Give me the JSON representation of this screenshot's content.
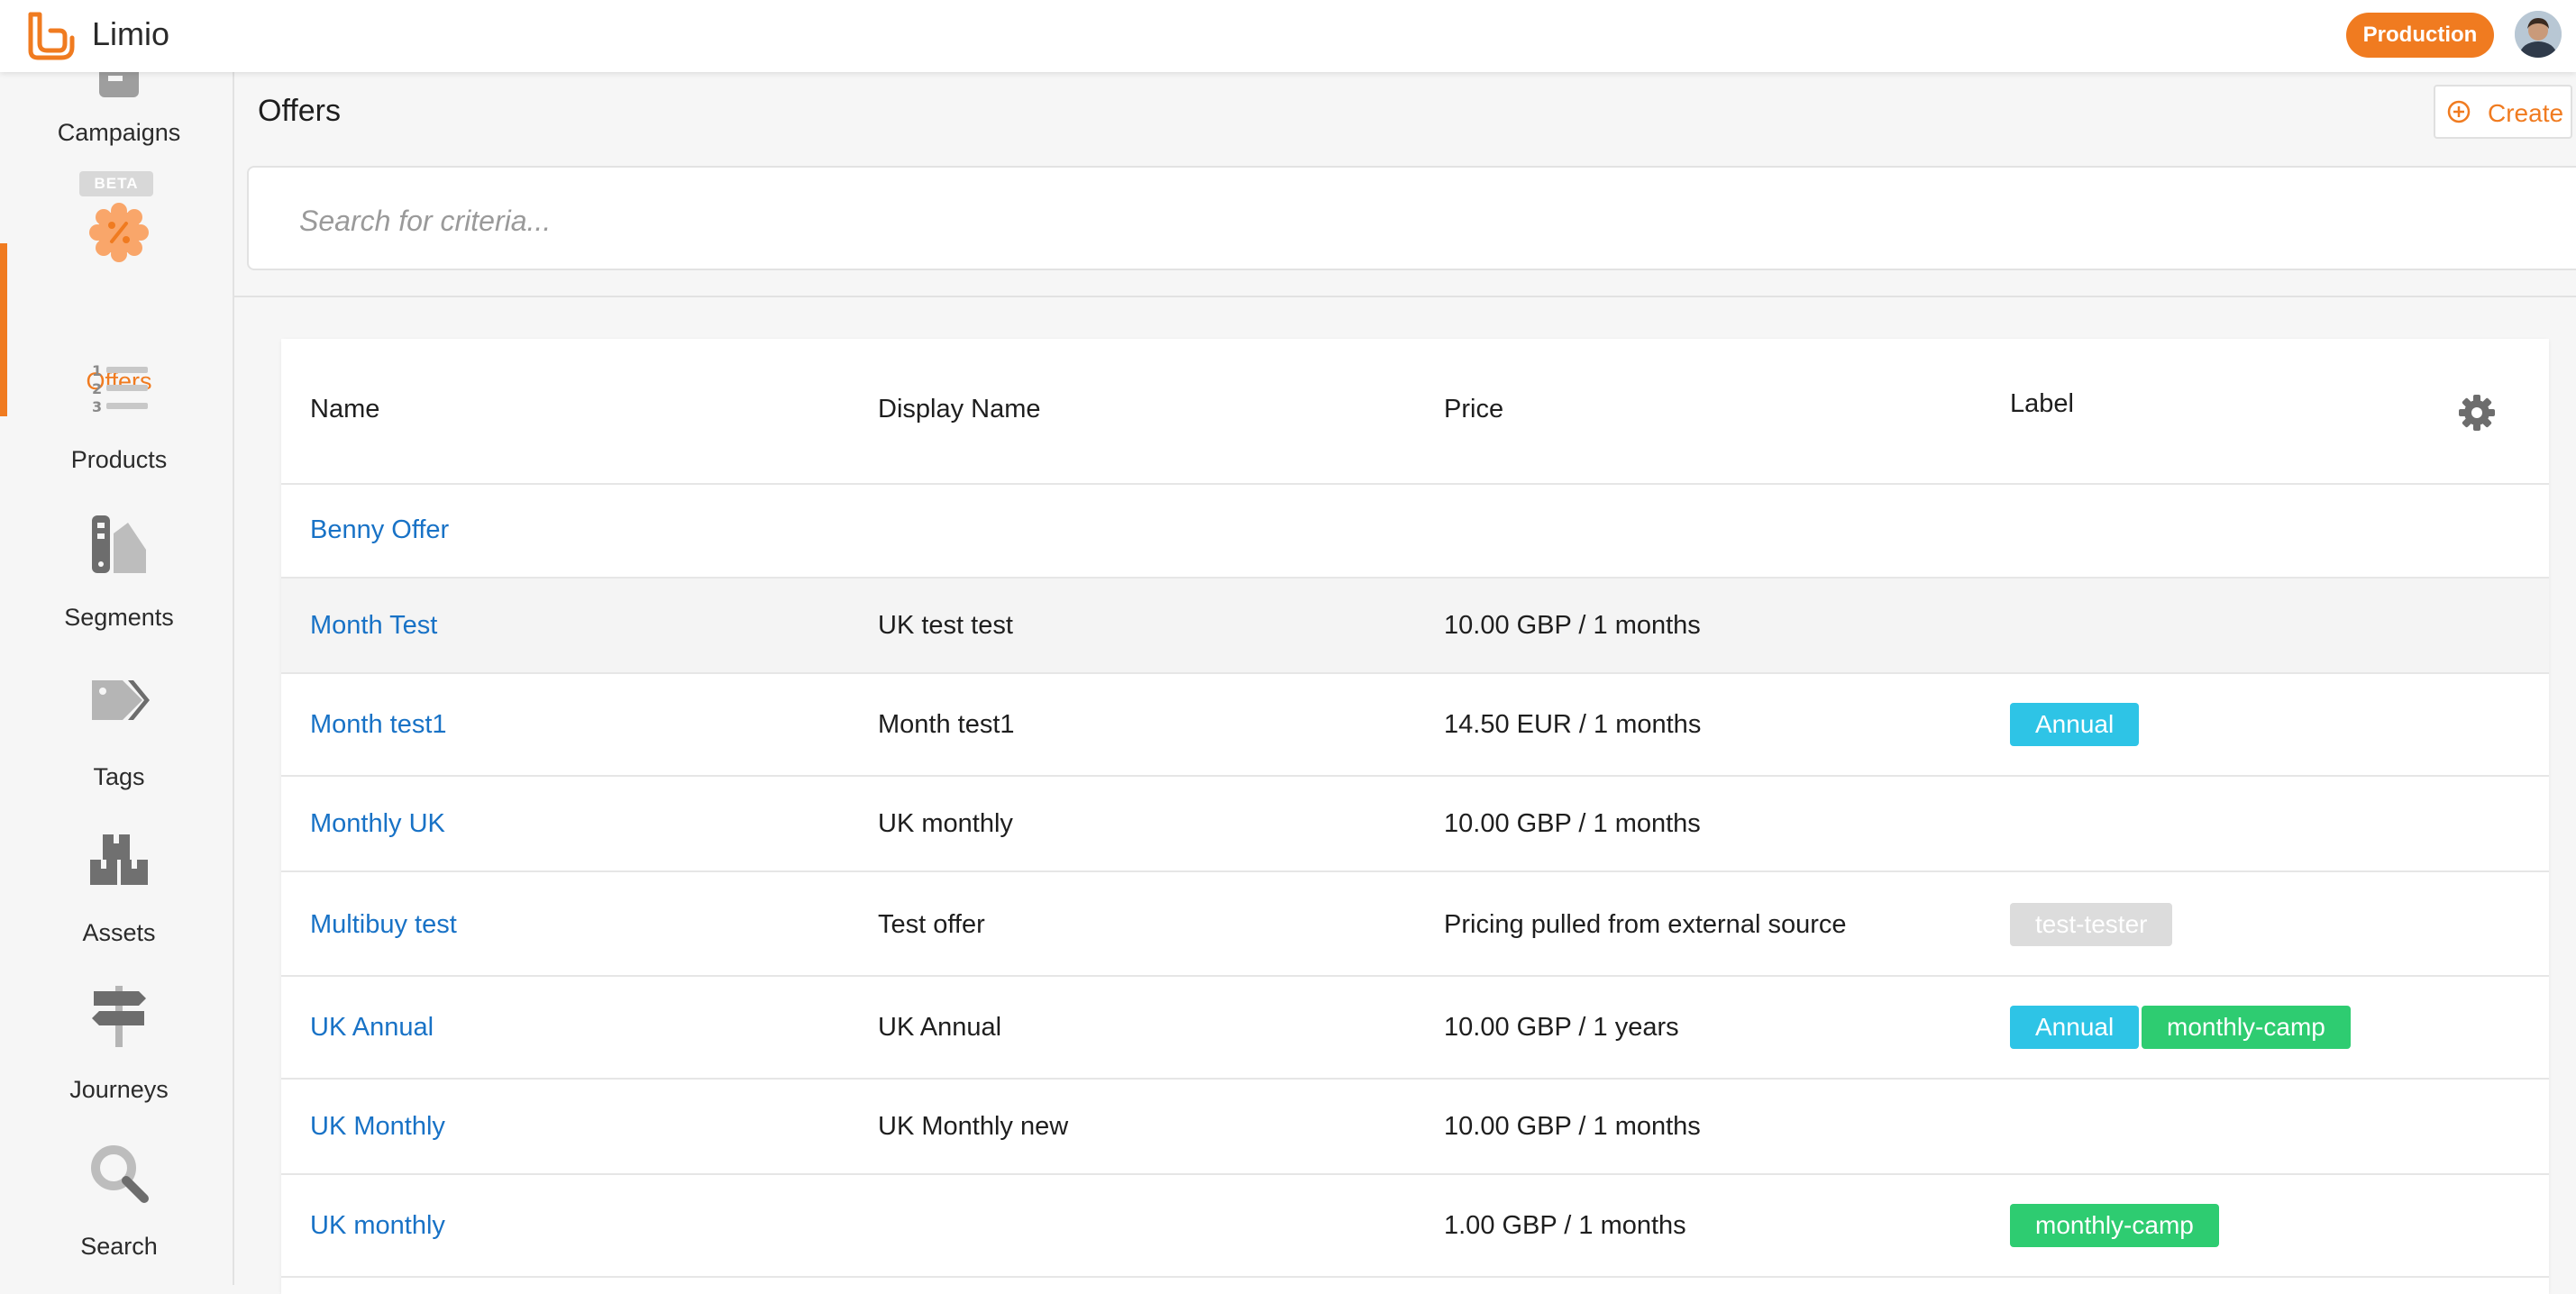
{
  "app": {
    "brand": "Limio",
    "environment": "Production"
  },
  "colors": {
    "accent": "#f07b20",
    "link": "#1872c6",
    "tag_blue": "#2ec4e6",
    "tag_green": "#2ecc71",
    "tag_grey": "#dcdcdc"
  },
  "sidebar": {
    "beta_badge": "BETA",
    "items": [
      {
        "label": "Campaigns",
        "icon": "campaigns-icon"
      },
      {
        "label": "Offers",
        "icon": "offers-icon",
        "active": true
      },
      {
        "label": "Products",
        "icon": "products-icon"
      },
      {
        "label": "Segments",
        "icon": "segments-icon"
      },
      {
        "label": "Tags",
        "icon": "tags-icon"
      },
      {
        "label": "Assets",
        "icon": "assets-icon"
      },
      {
        "label": "Journeys",
        "icon": "journeys-icon"
      },
      {
        "label": "Search",
        "icon": "search-icon"
      }
    ]
  },
  "page": {
    "title": "Offers",
    "create_label": "Create"
  },
  "search": {
    "placeholder": "Search for criteria..."
  },
  "table": {
    "headers": {
      "name": "Name",
      "display_name": "Display Name",
      "price": "Price",
      "label": "Label"
    },
    "rows": [
      {
        "name": "Benny Offer",
        "display_name": "",
        "price": "",
        "labels": []
      },
      {
        "name": "Month Test",
        "display_name": "UK test test",
        "price": "10.00 GBP / 1 months",
        "labels": []
      },
      {
        "name": "Month test1",
        "display_name": "Month test1",
        "price": "14.50 EUR / 1 months",
        "labels": [
          {
            "text": "Annual",
            "color": "blue"
          }
        ]
      },
      {
        "name": "Monthly UK",
        "display_name": "UK monthly",
        "price": "10.00 GBP / 1 months",
        "labels": []
      },
      {
        "name": "Multibuy test",
        "display_name": "Test offer",
        "price": "Pricing pulled from external source",
        "labels": [
          {
            "text": "test-tester",
            "color": "grey"
          }
        ]
      },
      {
        "name": "UK Annual",
        "display_name": "UK Annual",
        "price": "10.00 GBP / 1 years",
        "labels": [
          {
            "text": "Annual",
            "color": "blue"
          },
          {
            "text": "monthly-camp",
            "color": "green"
          }
        ]
      },
      {
        "name": "UK Monthly",
        "display_name": "UK Monthly new",
        "price": "10.00 GBP / 1 months",
        "labels": []
      },
      {
        "name": "UK monthly",
        "display_name": "",
        "price": "1.00 GBP / 1 months",
        "labels": [
          {
            "text": "monthly-camp",
            "color": "green"
          }
        ]
      }
    ]
  }
}
